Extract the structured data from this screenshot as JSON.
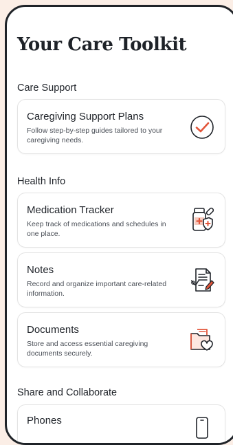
{
  "page": {
    "title": "Your Care Toolkit"
  },
  "sections": [
    {
      "title": "Care Support",
      "cards": [
        {
          "title": "Caregiving Support Plans",
          "description": "Follow step-by-step guides tailored to your caregiving needs.",
          "icon": "checkmark-circle-icon"
        }
      ]
    },
    {
      "title": "Health Info",
      "cards": [
        {
          "title": "Medication Tracker",
          "description": "Keep track of medications and schedules in one place.",
          "icon": "medication-bottle-icon"
        },
        {
          "title": "Notes",
          "description": "Record and organize important care-related information.",
          "icon": "notes-document-icon"
        },
        {
          "title": "Documents",
          "description": "Store and access essential caregiving documents securely.",
          "icon": "folder-heart-icon"
        }
      ]
    },
    {
      "title": "Share and Collaborate",
      "cards": [
        {
          "title": "Phones",
          "icon": "phone-icon"
        }
      ]
    }
  ],
  "colors": {
    "background": "#fbeee6",
    "accent": "#e2553a",
    "text": "#1e2228"
  }
}
